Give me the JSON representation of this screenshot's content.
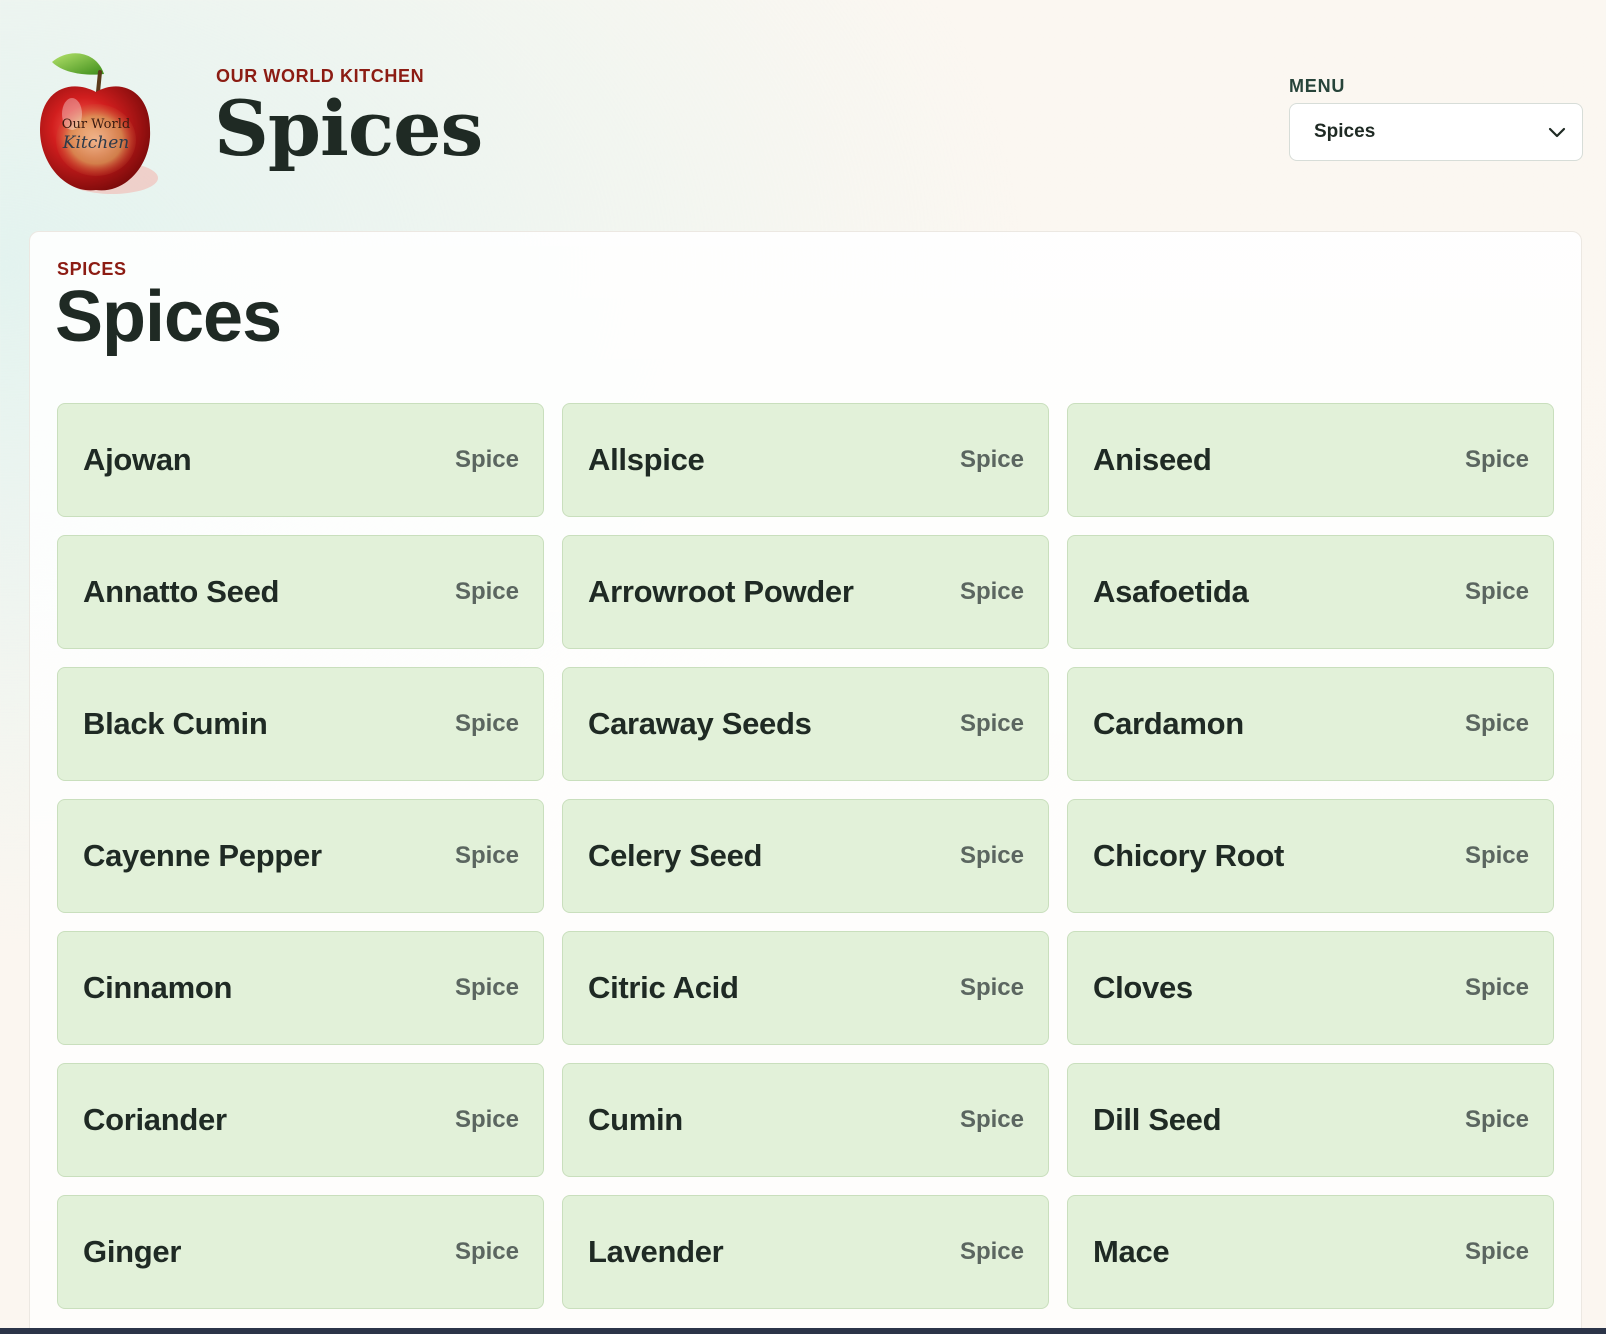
{
  "header": {
    "logo_text_line1": "Our World",
    "logo_text_line2": "Kitchen",
    "eyebrow": "OUR WORLD KITCHEN",
    "title": "Spices"
  },
  "menu": {
    "label": "MENU",
    "selected": "Spices"
  },
  "section": {
    "eyebrow": "SPICES",
    "title": "Spices"
  },
  "items": [
    {
      "name": "Ajowan",
      "type": "Spice"
    },
    {
      "name": "Allspice",
      "type": "Spice"
    },
    {
      "name": "Aniseed",
      "type": "Spice"
    },
    {
      "name": "Annatto Seed",
      "type": "Spice"
    },
    {
      "name": "Arrowroot Powder",
      "type": "Spice"
    },
    {
      "name": "Asafoetida",
      "type": "Spice"
    },
    {
      "name": "Black Cumin",
      "type": "Spice"
    },
    {
      "name": "Caraway Seeds",
      "type": "Spice"
    },
    {
      "name": "Cardamon",
      "type": "Spice"
    },
    {
      "name": "Cayenne Pepper",
      "type": "Spice"
    },
    {
      "name": "Celery Seed",
      "type": "Spice"
    },
    {
      "name": "Chicory Root",
      "type": "Spice"
    },
    {
      "name": "Cinnamon",
      "type": "Spice"
    },
    {
      "name": "Citric Acid",
      "type": "Spice"
    },
    {
      "name": "Cloves",
      "type": "Spice"
    },
    {
      "name": "Coriander",
      "type": "Spice"
    },
    {
      "name": "Cumin",
      "type": "Spice"
    },
    {
      "name": "Dill Seed",
      "type": "Spice"
    },
    {
      "name": "Ginger",
      "type": "Spice"
    },
    {
      "name": "Lavender",
      "type": "Spice"
    },
    {
      "name": "Mace",
      "type": "Spice"
    }
  ],
  "colors": {
    "accent": "#8c1c13",
    "card_bg": "#e2f1d9",
    "text": "#1f2a24"
  }
}
